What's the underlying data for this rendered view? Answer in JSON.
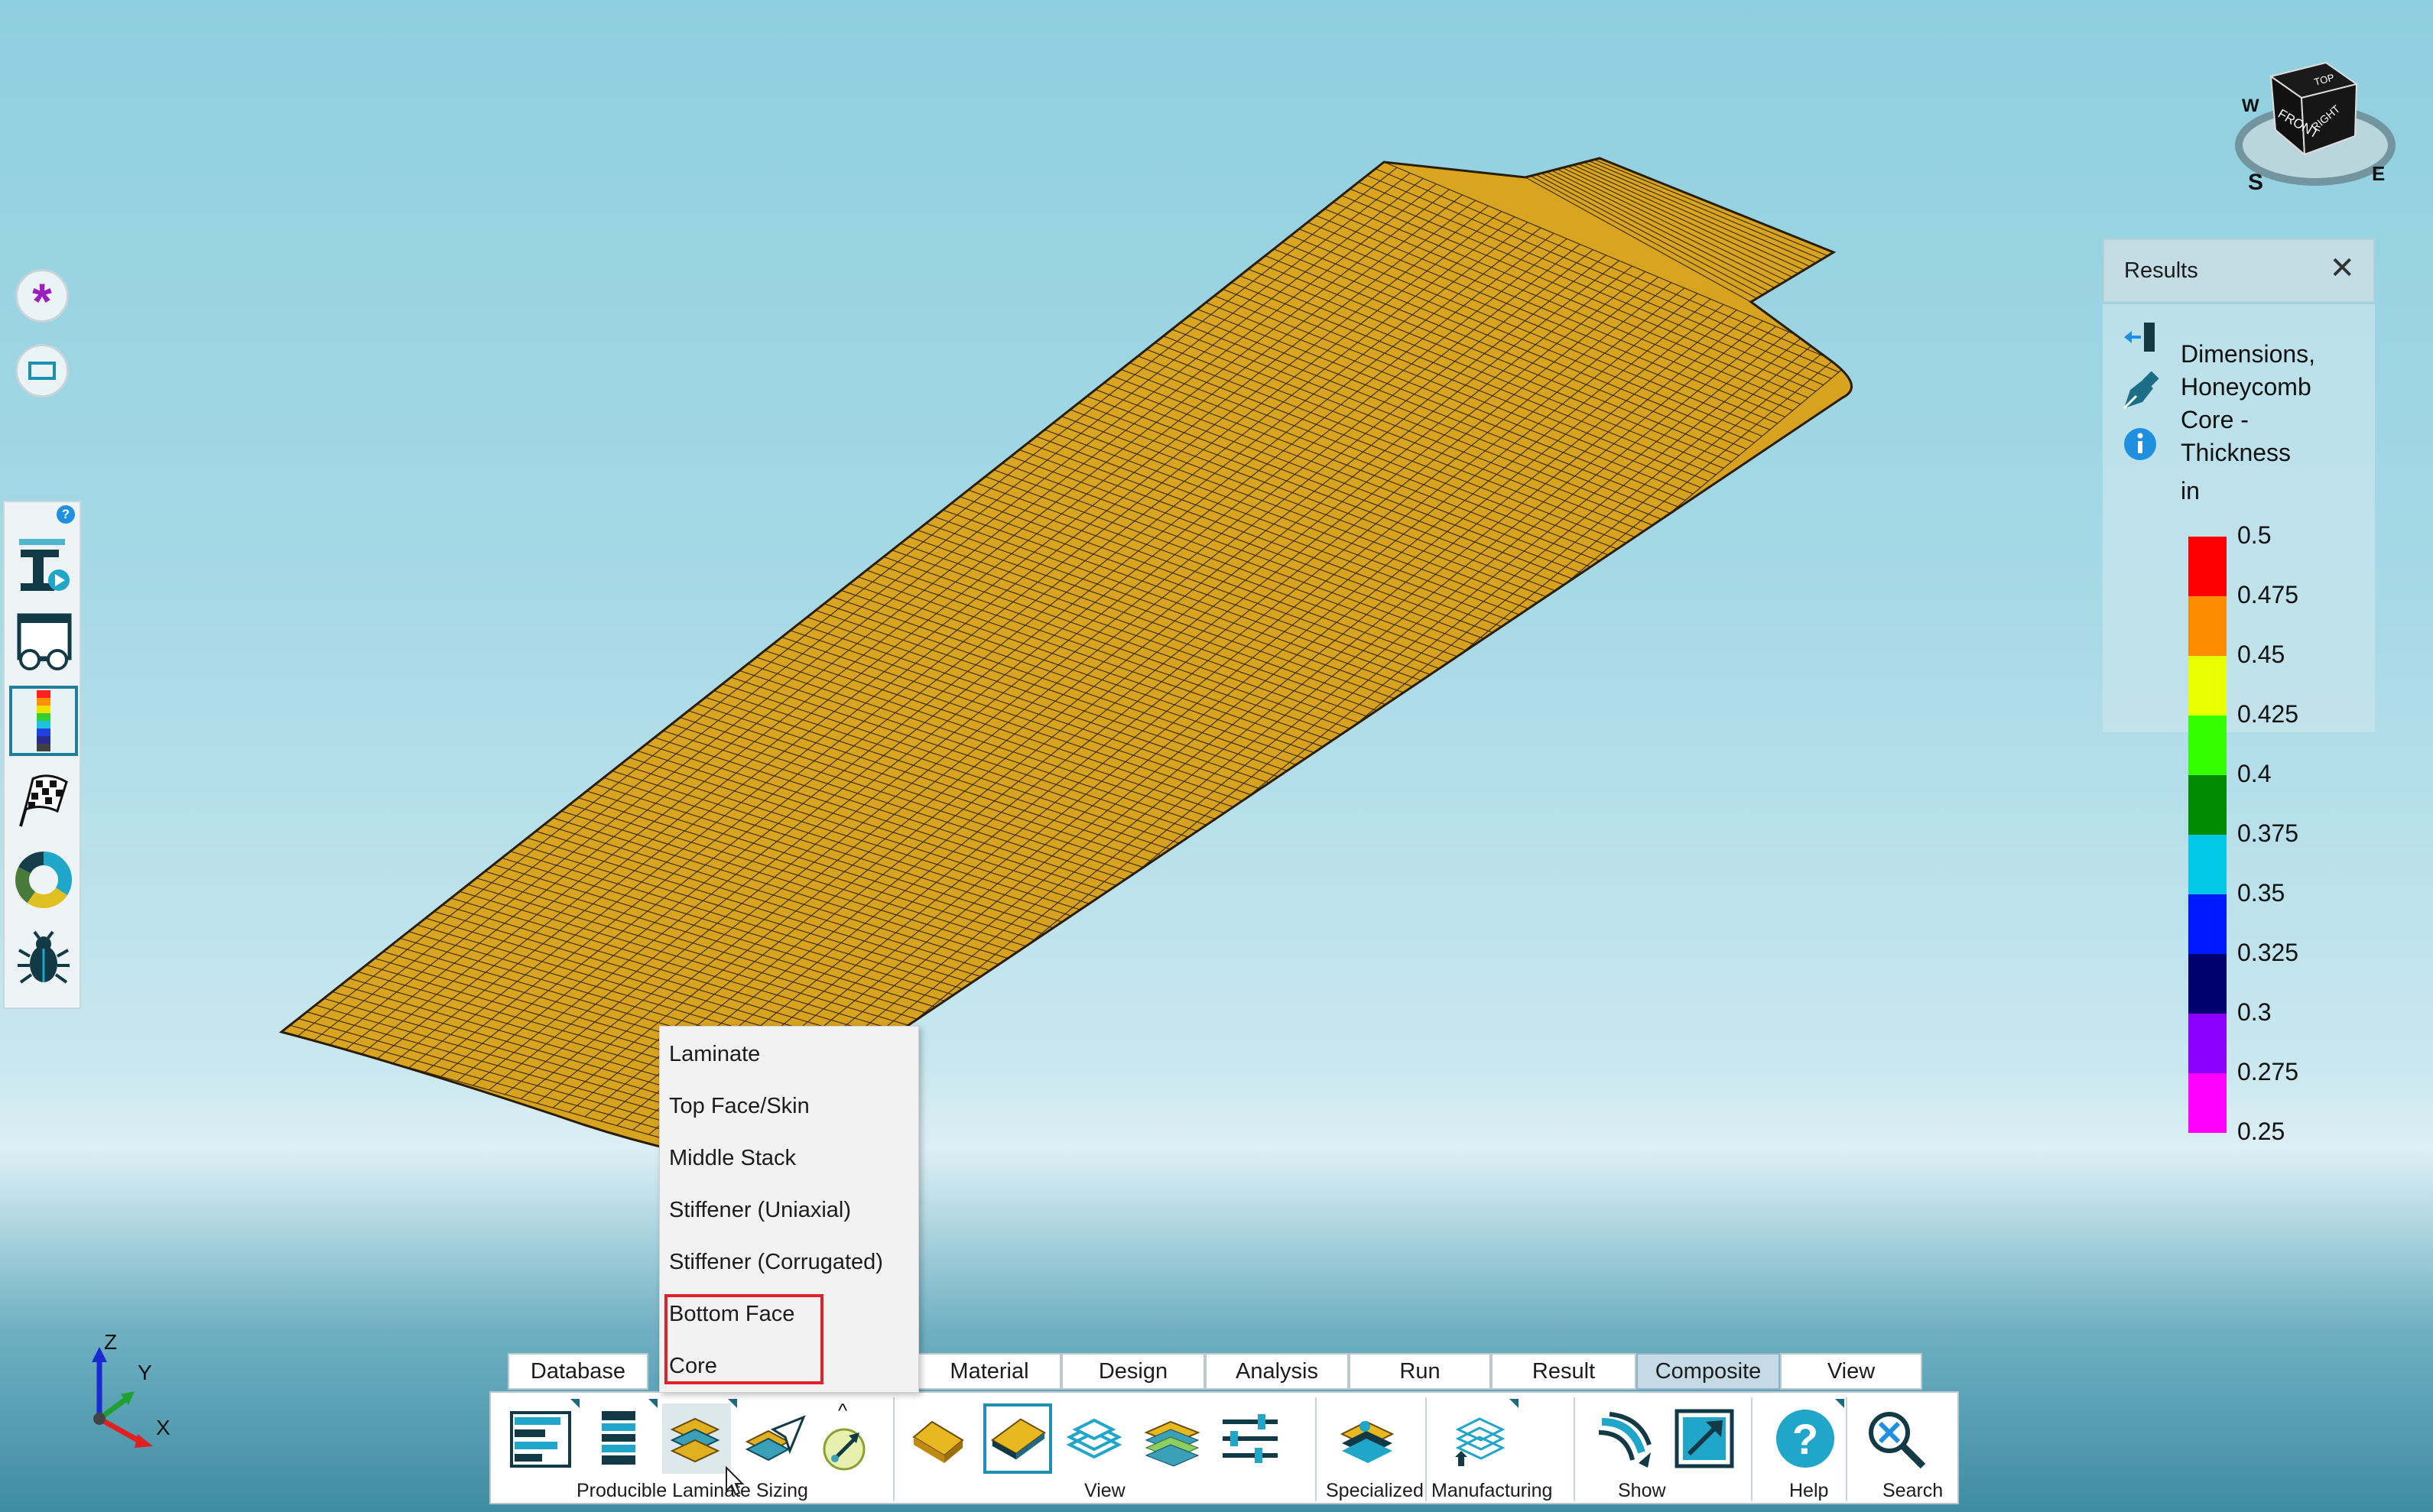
{
  "viewcube": {
    "top": "TOP",
    "front": "FRONT",
    "right": "RIGHT",
    "compass_s": "S",
    "compass_e": "E",
    "compass_w": "W"
  },
  "quick_buttons": [
    {
      "name": "asterisk-icon",
      "color": "#9b1fbf"
    },
    {
      "name": "rectangle-select-icon",
      "color": "#1c8fb5"
    }
  ],
  "left_tools": [
    {
      "name": "i-beam-play-icon"
    },
    {
      "name": "presentation-glasses-icon"
    },
    {
      "name": "color-legend-icon",
      "active": true
    },
    {
      "name": "checkered-flag-icon"
    },
    {
      "name": "donut-chart-icon"
    },
    {
      "name": "bug-icon"
    }
  ],
  "help_badge": "?",
  "results": {
    "title": "Results",
    "close": "✕",
    "description_lines": [
      "Dimensions,",
      "Honeycomb",
      "Core -",
      "Thickness"
    ],
    "unit": "in"
  },
  "legend": {
    "labels": [
      "0.5",
      "0.475",
      "0.45",
      "0.425",
      "0.4",
      "0.375",
      "0.35",
      "0.325",
      "0.3",
      "0.275",
      "0.25"
    ],
    "colors": [
      "#ff0000",
      "#ff8c00",
      "#e8ff00",
      "#33ff00",
      "#008c00",
      "#00c8e6",
      "#0019ff",
      "#00006e",
      "#8c00ff",
      "#ff00ff"
    ]
  },
  "dropdown": {
    "items": [
      "Laminate",
      "Top Face/Skin",
      "Middle Stack",
      "Stiffener (Uniaxial)",
      "Stiffener (Corrugated)",
      "Bottom Face",
      "Core"
    ],
    "highlighted": [
      "Bottom Face",
      "Core"
    ]
  },
  "tabs": [
    {
      "label": "Database",
      "active": false
    },
    {
      "label": "Material",
      "active": false
    },
    {
      "label": "Design",
      "active": false
    },
    {
      "label": "Analysis",
      "active": false
    },
    {
      "label": "Run",
      "active": false
    },
    {
      "label": "Result",
      "active": false
    },
    {
      "label": "Composite",
      "active": true
    },
    {
      "label": "View",
      "active": false
    }
  ],
  "toolbar_groups": [
    {
      "label": "Producible Laminate Sizing"
    },
    {
      "label": "View"
    },
    {
      "label": "Specialized"
    },
    {
      "label": "Manufacturing"
    },
    {
      "label": "Show"
    },
    {
      "label": "Help"
    },
    {
      "label": "Search"
    }
  ],
  "collapse_glyph": "^",
  "triad": {
    "z": "Z",
    "y": "Y",
    "x": "X"
  },
  "colors": {
    "mesh": "#d9a520",
    "mesh_line": "#2a1d05",
    "accent": "#1f8fb3",
    "highlight_box": "#e0202a"
  }
}
